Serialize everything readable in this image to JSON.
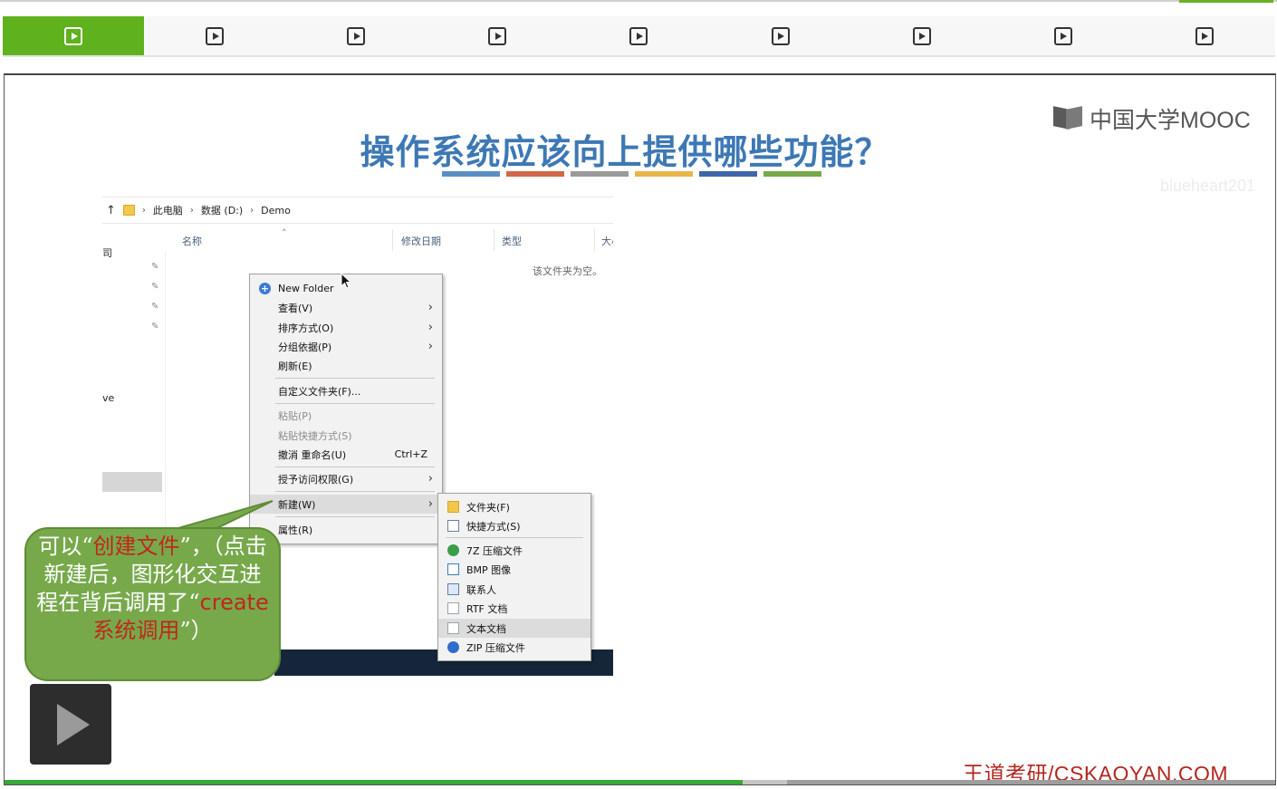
{
  "tabs": [
    {
      "label": "",
      "icon": "play-square-icon",
      "active": true
    },
    {
      "label": "",
      "icon": "play-square-icon",
      "active": false
    },
    {
      "label": "",
      "icon": "play-square-icon",
      "active": false
    },
    {
      "label": "",
      "icon": "play-square-icon",
      "active": false
    },
    {
      "label": "",
      "icon": "play-square-icon",
      "active": false
    },
    {
      "label": "",
      "icon": "play-square-icon",
      "active": false
    },
    {
      "label": "",
      "icon": "play-square-icon",
      "active": false
    },
    {
      "label": "",
      "icon": "play-square-icon",
      "active": false
    },
    {
      "label": "",
      "icon": "play-square-icon",
      "active": false
    }
  ],
  "colors": {
    "accent_green": "#5fb21d",
    "title_blue": "#3d78b5",
    "callout_green": "#77a94b",
    "brand_red": "#b5261e",
    "bars": [
      "#5b8fc4",
      "#d0684a",
      "#9a9a9a",
      "#e8b54a",
      "#3f66a8",
      "#78a84a"
    ]
  },
  "slide": {
    "title": "操作系统应该向上提供哪些功能？",
    "logo_text": "中国大学MOOC",
    "watermark": "blueheart201",
    "footer_brand": "王道考研/CSKAOYAN.COM"
  },
  "explorer": {
    "breadcrumb": [
      "此电脑",
      "数据 (D:)",
      "Demo"
    ],
    "columns": [
      "名称",
      "修改日期",
      "类型",
      "大小"
    ],
    "nav_fragments": [
      "司",
      "ve"
    ],
    "empty_message": "该文件夹为空。",
    "context_menu": [
      {
        "label": "New Folder",
        "icon": "plus-circle-icon"
      },
      {
        "label": "查看(V)",
        "submenu": true
      },
      {
        "label": "排序方式(O)",
        "submenu": true
      },
      {
        "label": "分组依据(P)",
        "submenu": true
      },
      {
        "label": "刷新(E)"
      },
      {
        "label": "自定义文件夹(F)..."
      },
      {
        "label": "粘贴(P)",
        "disabled": true
      },
      {
        "label": "粘贴快捷方式(S)",
        "disabled": true
      },
      {
        "label": "撤消 重命名(U)",
        "shortcut": "Ctrl+Z"
      },
      {
        "label": "授予访问权限(G)",
        "submenu": true
      },
      {
        "label": "新建(W)",
        "submenu": true,
        "highlighted": true
      },
      {
        "label": "属性(R)"
      }
    ],
    "new_submenu": [
      {
        "label": "文件夹(F)",
        "icon": "folder-icon"
      },
      {
        "label": "快捷方式(S)",
        "icon": "shortcut-icon"
      },
      {
        "label": "7Z 压缩文件",
        "icon": "archive-7z-icon"
      },
      {
        "label": "BMP 图像",
        "icon": "bmp-image-icon"
      },
      {
        "label": "联系人",
        "icon": "contact-card-icon"
      },
      {
        "label": "RTF 文档",
        "icon": "rtf-document-icon"
      },
      {
        "label": "文本文档",
        "icon": "text-document-icon",
        "highlighted": true
      },
      {
        "label": "ZIP 压缩文件",
        "icon": "zip-archive-icon"
      }
    ]
  },
  "callout": {
    "p1": "可以“",
    "p2": "创建文件",
    "p3": "”，（点击新建后，图形化交互进程在背后调用了“",
    "p4": "create 系统调用",
    "p5": "”）"
  },
  "player": {
    "progress_fraction": 0.58,
    "buffered_end_fraction": 0.615
  }
}
